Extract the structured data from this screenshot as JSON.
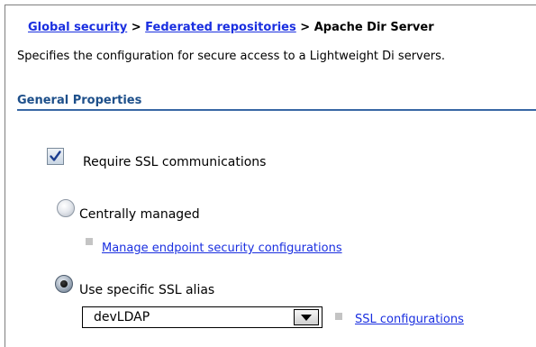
{
  "breadcrumb": {
    "items": [
      "Global security",
      "Federated repositories",
      "Apache Dir Server"
    ],
    "separator": ">"
  },
  "description": "Specifies the configuration for secure access to a Lightweight Di servers.",
  "general_properties": {
    "title": "General Properties",
    "require_ssl": {
      "label": "Require SSL communications",
      "checked": true
    },
    "centrally_managed": {
      "label": "Centrally managed",
      "selected": false
    },
    "manage_endpoint_link": "Manage endpoint security configurations",
    "use_specific_alias": {
      "label": "Use specific SSL alias",
      "selected": true
    },
    "ssl_alias_select": {
      "value": "devLDAP"
    },
    "ssl_configurations_link": "SSL configurations"
  },
  "colors": {
    "link": "#1a2fe0",
    "section_title": "#1d4f8a",
    "section_rule": "#3867a4",
    "bullet": "#c4c4c4"
  }
}
